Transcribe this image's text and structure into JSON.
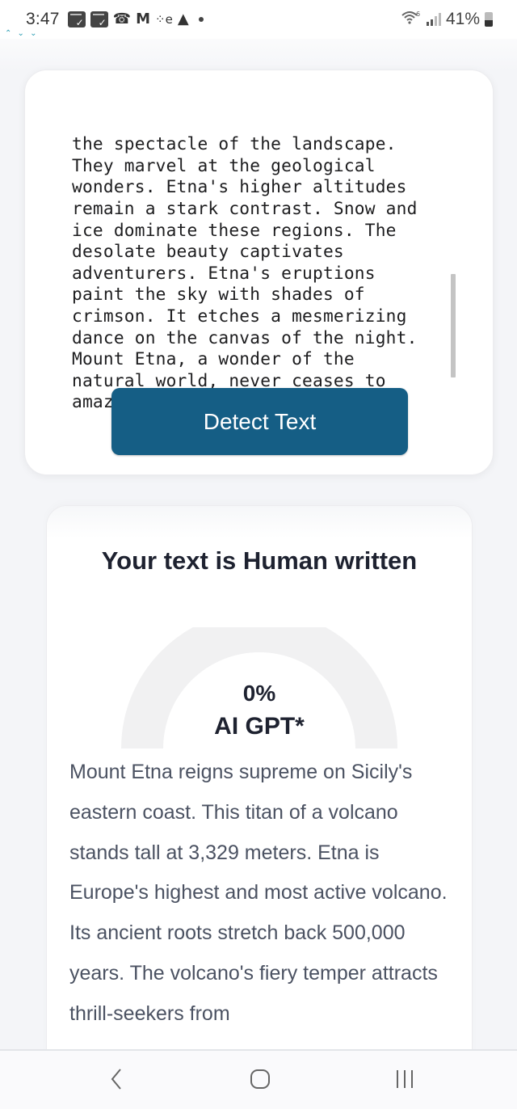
{
  "status_bar": {
    "time": "3:47",
    "notification_icons": [
      "calendar-check-icon",
      "calendar-check-icon",
      "missed-call-icon",
      "gmail-icon",
      "app-e-icon",
      "warning-icon",
      "more-dot-icon"
    ],
    "wifi_label": "6",
    "battery_percent": "41%",
    "battery_level": 0.41
  },
  "input_card": {
    "text_lines": [
      "the spectacle of the landscape.",
      "They marvel at the geological",
      "wonders. Etna's higher altitudes",
      "remain a stark contrast. Snow and",
      "ice dominate these regions. The",
      "desolate beauty captivates",
      "adventurers. Etna's eruptions",
      "paint the sky with shades of",
      "crimson. It etches a mesmerizing",
      "dance on the canvas of the night.",
      "Mount Etna, a wonder of the",
      "natural world, never ceases to",
      "amaze."
    ],
    "detect_button_label": "Detect Text",
    "button_color": "#155e85"
  },
  "result_card": {
    "title": "Your text is Human written",
    "gauge": {
      "value_label": "0%",
      "ai_fraction": 0.0,
      "label": "AI GPT*",
      "track_color": "#f1f1f2"
    },
    "paragraph": "Mount Etna reigns supreme on Sicily's eastern coast. This titan of a volcano stands tall at 3,329 meters. Etna is Europe's highest and most active volcano. Its ancient roots stretch back 500,000 years. The volcano's fiery temper attracts thrill-seekers from"
  },
  "nav_bar": {
    "buttons": [
      "back",
      "home",
      "recents"
    ]
  }
}
